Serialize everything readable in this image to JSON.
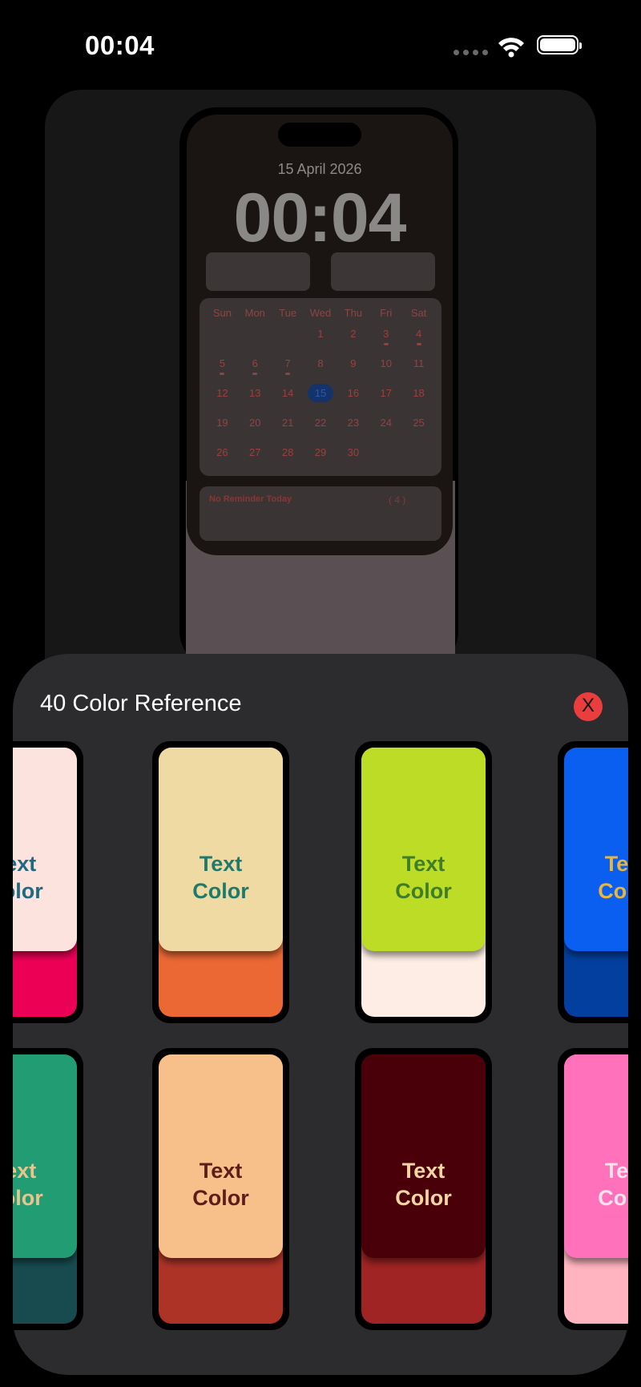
{
  "status_bar": {
    "time": "00:04"
  },
  "preview": {
    "date": "15 April 2026",
    "time": "00:04",
    "weekdays": [
      "Sun",
      "Mon",
      "Tue",
      "Wed",
      "Thu",
      "Fri",
      "Sat"
    ],
    "days": [
      "",
      "",
      "",
      "1",
      "2",
      "3",
      "4",
      "5",
      "6",
      "7",
      "8",
      "9",
      "10",
      "11",
      "12",
      "13",
      "14",
      "15",
      "16",
      "17",
      "18",
      "19",
      "20",
      "21",
      "22",
      "23",
      "24",
      "25",
      "26",
      "27",
      "28",
      "29",
      "30"
    ],
    "today": "15",
    "marked_days": [
      "3",
      "4",
      "5",
      "6",
      "7"
    ],
    "reminder_text": "No Reminder Today",
    "reminder_count": "( 4 )"
  },
  "sheet": {
    "title": "40 Color Reference",
    "close_label": "X"
  },
  "swatch_label": {
    "line1": "Text",
    "line2": "Color"
  },
  "swatches": [
    {
      "top": "#fde3dd",
      "bottom": "#ec0055",
      "text": "#1e6a80"
    },
    {
      "top": "#f0daa4",
      "bottom": "#eb6834",
      "text": "#1f7a6c"
    },
    {
      "top": "#bddc26",
      "bottom": "#fdede4",
      "text": "#3f7d2a"
    },
    {
      "top": "#0a5ef0",
      "bottom": "#033f9e",
      "text": "#e9b63a"
    },
    {
      "top": "#229c73",
      "bottom": "#184b4f",
      "text": "#e6c58e"
    },
    {
      "top": "#f7c08a",
      "bottom": "#ad3327",
      "text": "#5a1f1a"
    },
    {
      "top": "#4a0008",
      "bottom": "#a12424",
      "text": "#f4d6a4"
    },
    {
      "top": "#ff72bb",
      "bottom": "#ffb4bf",
      "text": "#fde3eb"
    }
  ]
}
